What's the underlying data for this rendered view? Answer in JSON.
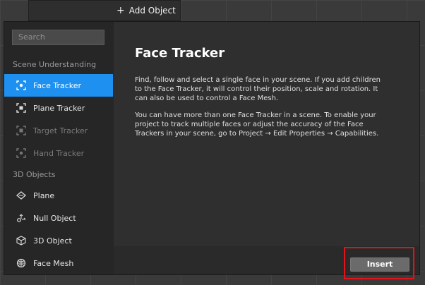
{
  "toolbar": {
    "add_object_label": "Add Object"
  },
  "sidebar": {
    "search_placeholder": "Search",
    "section_scene": "Scene Understanding",
    "section_3d": "3D Objects",
    "items": [
      {
        "label": "Face Tracker",
        "icon": "face-tracker-icon"
      },
      {
        "label": "Plane Tracker",
        "icon": "plane-tracker-icon"
      },
      {
        "label": "Target Tracker",
        "icon": "target-tracker-icon"
      },
      {
        "label": "Hand Tracker",
        "icon": "hand-tracker-icon"
      },
      {
        "label": "Plane",
        "icon": "plane-icon"
      },
      {
        "label": "Null Object",
        "icon": "null-object-icon"
      },
      {
        "label": "3D Object",
        "icon": "cube-icon"
      },
      {
        "label": "Face Mesh",
        "icon": "face-mesh-icon"
      }
    ]
  },
  "content": {
    "title": "Face Tracker",
    "paragraph1": "Find, follow and select a single face in your scene. If you add children to the Face Tracker, it will control their position, scale and rotation. It can also be used to control a Face Mesh.",
    "paragraph2": "You can have more than one Face Tracker in a scene. To enable your project to track multiple faces or adjust the accuracy of the Face Trackers in your scene, go to Project → Edit Properties → Capabilities."
  },
  "footer": {
    "insert_label": "Insert"
  },
  "colors": {
    "accent": "#1e90f0",
    "highlight": "#e0141a"
  }
}
